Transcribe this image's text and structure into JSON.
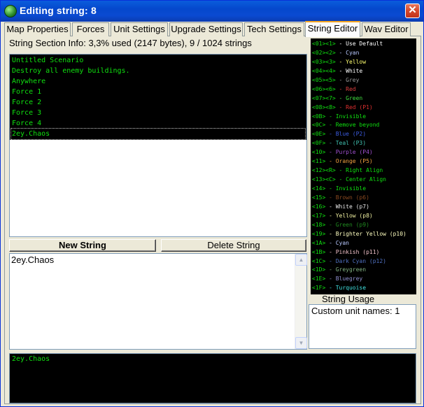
{
  "window": {
    "title": "Editing string: 8",
    "close_label": "✕"
  },
  "tabs": [
    {
      "label": "Map Properties"
    },
    {
      "label": "Forces"
    },
    {
      "label": "Unit Settings"
    },
    {
      "label": "Upgrade Settings"
    },
    {
      "label": "Tech Settings"
    },
    {
      "label": "String Editor"
    },
    {
      "label": "Wav Editor"
    }
  ],
  "active_tab": "String Editor",
  "info": {
    "text": "String Section Info: 3,3% used (2147 bytes), 9 / 1024 strings"
  },
  "strings": [
    "Untitled Scenario",
    "Destroy all enemy buildings.",
    "Anywhere",
    "Force 1",
    "Force 2",
    "Force 3",
    "Force 4",
    "2ey.Chaos"
  ],
  "selected_index": 7,
  "buttons": {
    "new_string": "New String",
    "delete_string": "Delete String"
  },
  "editor": {
    "value": "2ey.Chaos"
  },
  "preview": {
    "text": "2ey.Chaos"
  },
  "color_codes": [
    {
      "code": "<01><1>",
      "label": " - Use Default",
      "color": "#ffffff"
    },
    {
      "code": "<02><2>",
      "label": " - Cyan",
      "color": "#b8c8ff"
    },
    {
      "code": "<03><3>",
      "label": " - Yellow",
      "color": "#ffff70"
    },
    {
      "code": "<04><4>",
      "label": " - White",
      "color": "#ffffff"
    },
    {
      "code": "<05><5>",
      "label": " - Grey",
      "color": "#9a9a9a"
    },
    {
      "code": "<06><6>",
      "label": " - Red",
      "color": "#e04040"
    },
    {
      "code": "<07><7>",
      "label": " - Green",
      "color": "#40e040"
    },
    {
      "code": "<08><8>",
      "label": " - Red (P1)",
      "color": "#e03030"
    },
    {
      "code": "<0B>",
      "label": " - Invisible",
      "color": "#10e010"
    },
    {
      "code": "<0C>",
      "label": " - Remove beyond",
      "color": "#10e010"
    },
    {
      "code": "<0E>",
      "label": " - Blue (P2)",
      "color": "#3c5ce0"
    },
    {
      "code": "<0F>",
      "label": " - Teal (P3)",
      "color": "#40c0b0"
    },
    {
      "code": "<10>",
      "label": " - Purple (P4)",
      "color": "#a050d0"
    },
    {
      "code": "<11>",
      "label": " - Orange (P5)",
      "color": "#f0a040"
    },
    {
      "code": "<12><R>",
      "label": " - Right Align",
      "color": "#10e010"
    },
    {
      "code": "<13><C>",
      "label": " - Center Align",
      "color": "#10e010"
    },
    {
      "code": "<14>",
      "label": " - Invisible",
      "color": "#10e010"
    },
    {
      "code": "<15>",
      "label": " - Brown (p6)",
      "color": "#8a4a20"
    },
    {
      "code": "<16>",
      "label": " - White (p7)",
      "color": "#e8e8e8"
    },
    {
      "code": "<17>",
      "label": " - Yellow (p8)",
      "color": "#f0f0a0"
    },
    {
      "code": "<18>",
      "label": " - Green (p9)",
      "color": "#208a20"
    },
    {
      "code": "<19>",
      "label": " - Brighter Yellow (p10)",
      "color": "#ffffc0"
    },
    {
      "code": "<1A>",
      "label": " - Cyan",
      "color": "#b8c8ff"
    },
    {
      "code": "<1B>",
      "label": " - Pinkish (p11)",
      "color": "#f0c0c8"
    },
    {
      "code": "<1C>",
      "label": " - Dark Cyan (p12)",
      "color": "#5070c0"
    },
    {
      "code": "<1D>",
      "label": " - Greygreen",
      "color": "#80b080"
    },
    {
      "code": "<1E>",
      "label": " - Bluegrey",
      "color": "#9090d0"
    },
    {
      "code": "<1F>",
      "label": " - Turquoise",
      "color": "#40e0e0"
    }
  ],
  "usage": {
    "label": "String Usage",
    "text": "Custom unit names: 1"
  },
  "colors": {
    "code_green": "#10e010",
    "title_bar": "#0548cc",
    "tab_highlight": "#f5a623"
  }
}
